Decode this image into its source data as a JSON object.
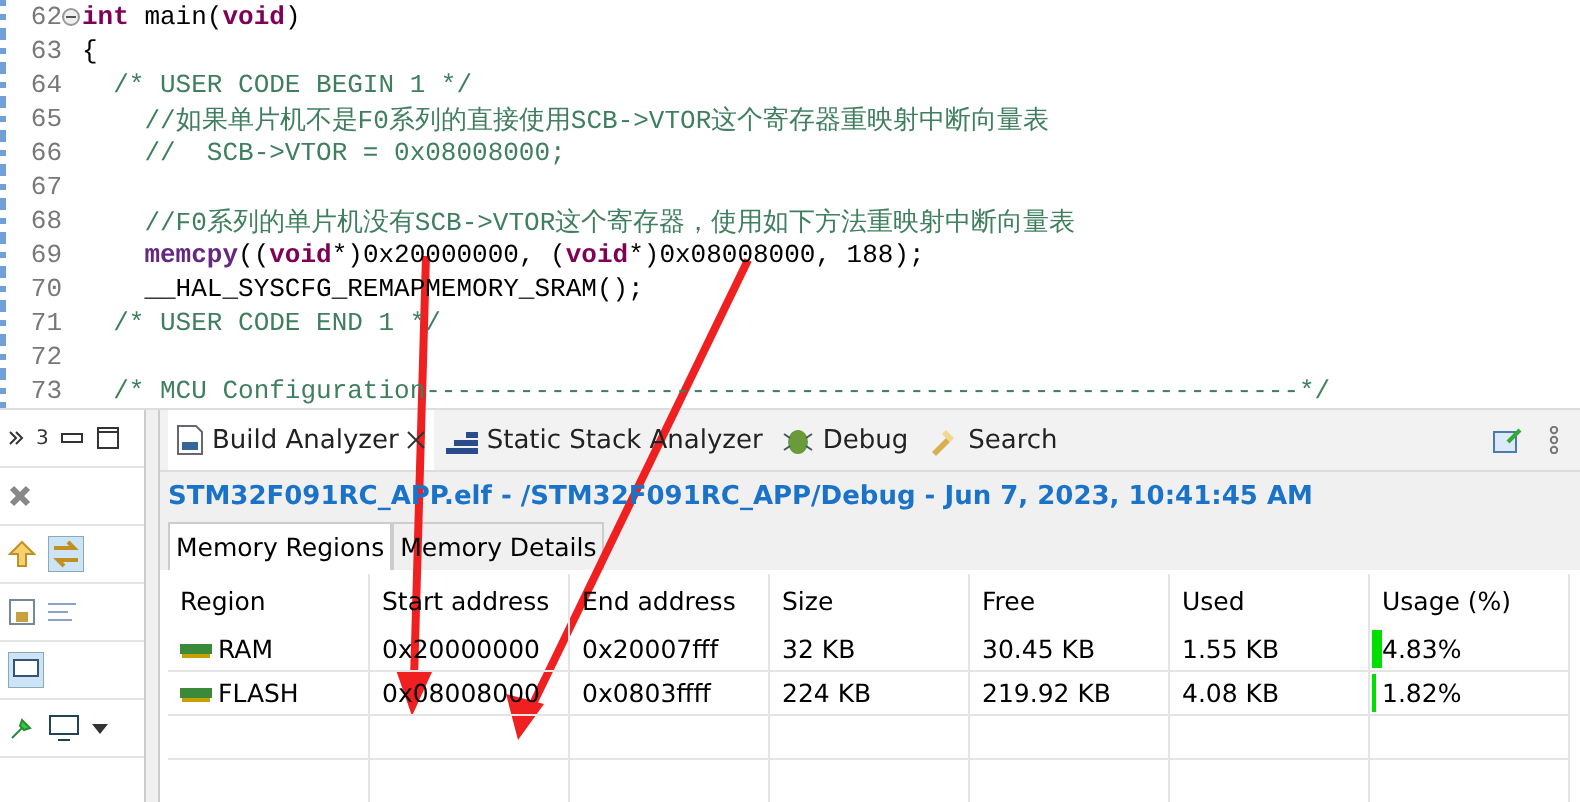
{
  "editor": {
    "lines": [
      {
        "number": "62",
        "fold": true,
        "tokens": [
          {
            "kind": "keyword",
            "text": "int"
          },
          {
            "kind": "plain",
            "text": " main("
          },
          {
            "kind": "keyword",
            "text": "void"
          },
          {
            "kind": "plain",
            "text": ")"
          }
        ]
      },
      {
        "number": "63",
        "fold": false,
        "tokens": [
          {
            "kind": "plain",
            "text": "{"
          }
        ]
      },
      {
        "number": "64",
        "fold": false,
        "tokens": [
          {
            "kind": "comment",
            "text": "  /* USER CODE BEGIN 1 */"
          }
        ]
      },
      {
        "number": "65",
        "fold": false,
        "tokens": [
          {
            "kind": "comment",
            "text": "    //如果单片机不是F0系列的直接使用SCB->VTOR这个寄存器重映射中断向量表"
          }
        ]
      },
      {
        "number": "66",
        "fold": false,
        "tokens": [
          {
            "kind": "comment",
            "text": "    //  SCB->VTOR = 0x08008000;"
          }
        ]
      },
      {
        "number": "67",
        "fold": false
      },
      {
        "number": "68",
        "fold": false,
        "tokens": [
          {
            "kind": "comment",
            "text": "    //F0系列的单片机没有SCB->VTOR这个寄存器，使用如下方法重映射中断向量表"
          }
        ]
      },
      {
        "number": "69",
        "fold": false,
        "tokens": [
          {
            "kind": "func",
            "text": "    memcpy"
          },
          {
            "kind": "plain",
            "text": "(("
          },
          {
            "kind": "keyword",
            "text": "void"
          },
          {
            "kind": "plain",
            "text": "*)0x20000000, ("
          },
          {
            "kind": "keyword",
            "text": "void"
          },
          {
            "kind": "plain",
            "text": "*)0x08008000, 188);"
          }
        ]
      },
      {
        "number": "70",
        "fold": false,
        "tokens": [
          {
            "kind": "plain",
            "text": "    __HAL_SYSCFG_REMAPMEMORY_SRAM();"
          }
        ]
      },
      {
        "number": "71",
        "fold": false,
        "tokens": [
          {
            "kind": "comment",
            "text": "  /* USER CODE END 1 */"
          }
        ]
      },
      {
        "number": "72",
        "fold": false
      },
      {
        "number": "73",
        "fold": false,
        "tokens": [
          {
            "kind": "comment",
            "text": "  /* MCU Configuration--------------------------------------------------------*/"
          }
        ]
      }
    ]
  },
  "left_panel": {
    "badge": "3"
  },
  "analyzer": {
    "tabs": [
      {
        "kind": "build",
        "label": "Build Analyzer",
        "selected": true,
        "closable": true
      },
      {
        "kind": "stack",
        "label": "Static Stack Analyzer",
        "selected": false,
        "closable": false
      },
      {
        "kind": "debug",
        "label": "Debug",
        "selected": false,
        "closable": false
      },
      {
        "kind": "search",
        "label": "Search",
        "selected": false,
        "closable": false
      }
    ],
    "title": "STM32F091RC_APP.elf - /STM32F091RC_APP/Debug - Jun 7, 2023, 10:41:45 AM",
    "subtabs": [
      {
        "label": "Memory Regions",
        "selected": true
      },
      {
        "label": "Memory Details",
        "selected": false
      }
    ],
    "table": {
      "columns": [
        "Region",
        "Start address",
        "End address",
        "Size",
        "Free",
        "Used",
        "Usage (%)"
      ],
      "rows": [
        {
          "region": "RAM",
          "start": "0x20000000",
          "end": "0x20007fff",
          "size": "32 KB",
          "free": "30.45 KB",
          "used": "1.55 KB",
          "usage": "4.83%",
          "level": 0.0483
        },
        {
          "region": "FLASH",
          "start": "0x08008000",
          "end": "0x0803ffff",
          "size": "224 KB",
          "free": "219.92 KB",
          "used": "4.08 KB",
          "usage": "1.82%",
          "level": 0.0182
        }
      ]
    }
  }
}
